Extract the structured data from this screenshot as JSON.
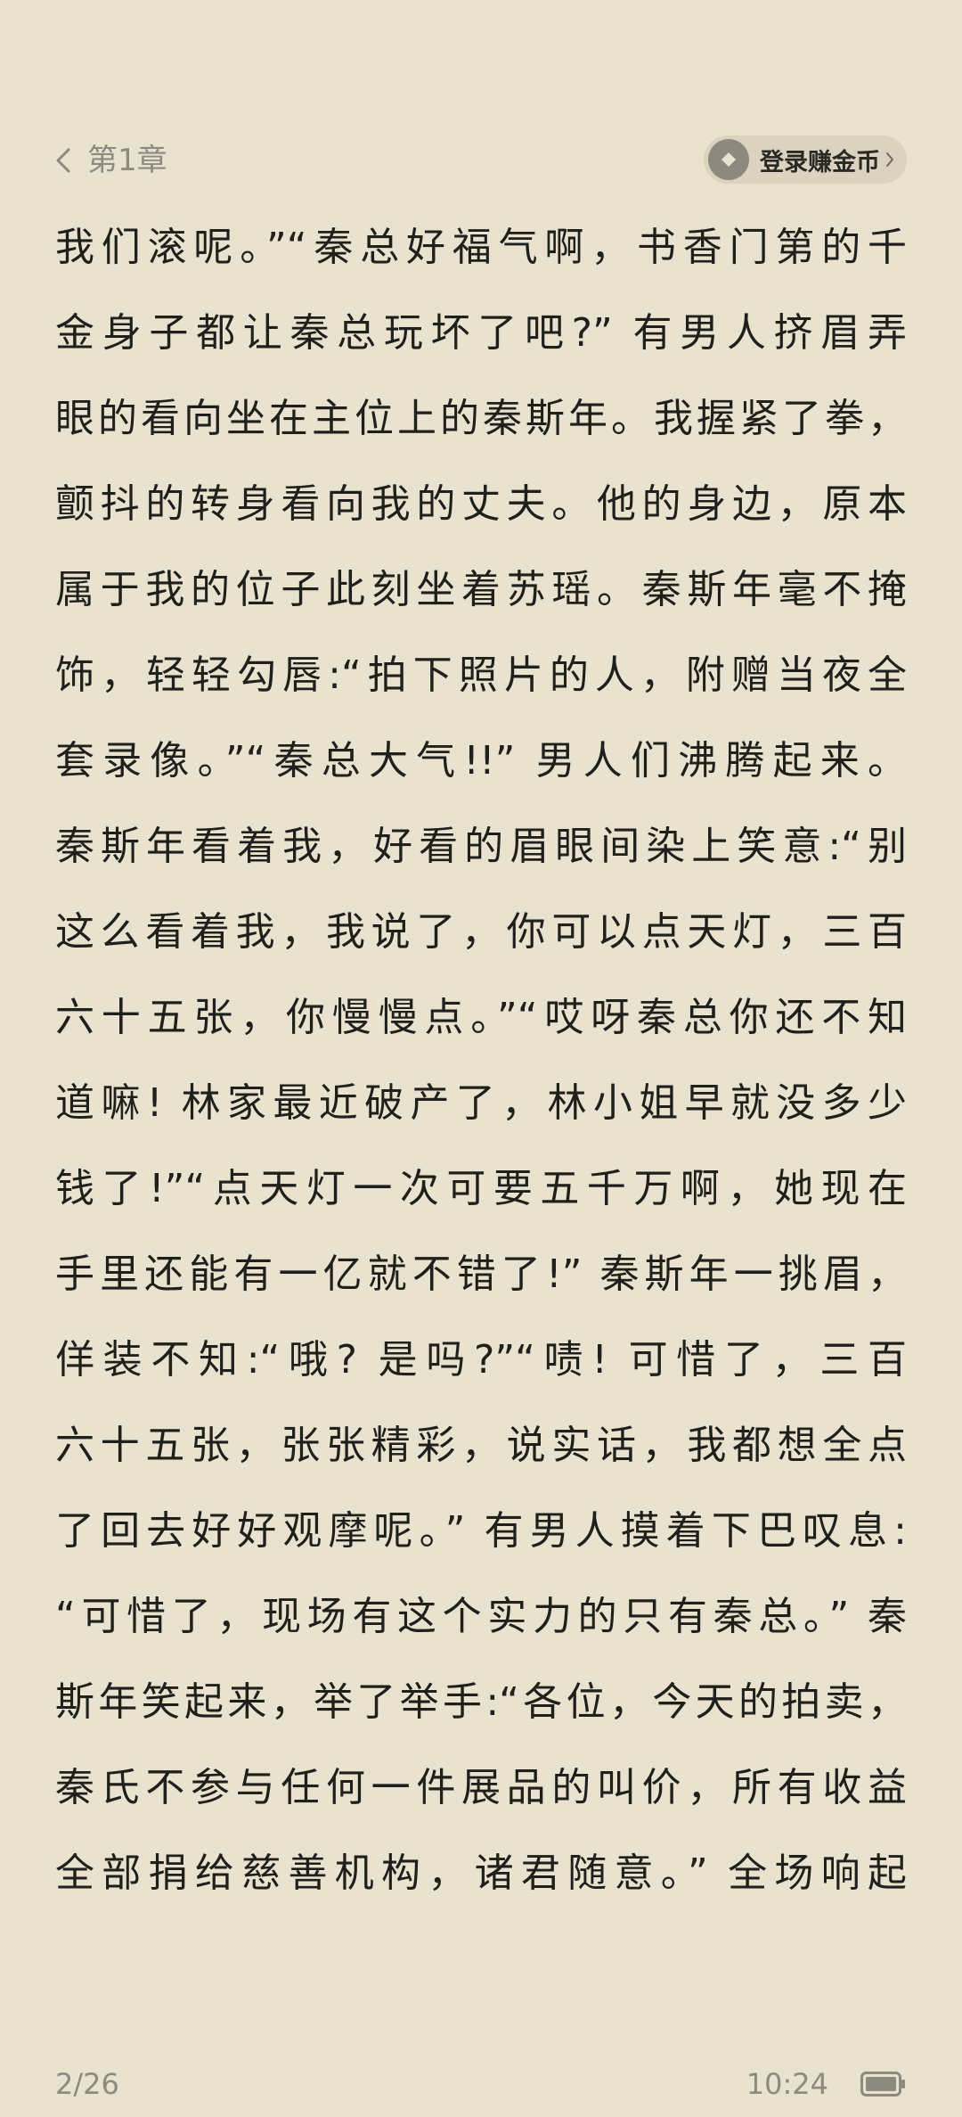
{
  "header": {
    "chapter": "第1章",
    "login_label": "登录赚金币"
  },
  "content": {
    "lines": [
      "我们滚呢。”“秦总好福气啊，书香门第的千",
      "金身子都让秦总玩坏了吧?” 有男人挤眉弄",
      "眼的看向坐在主位上的秦斯年。我握紧了拳，",
      "颤抖的转身看向我的丈夫。他的身边，原本",
      "属于我的位子此刻坐着苏瑶。秦斯年毫不掩",
      "饰，轻轻勾唇:“拍下照片的人，附赠当夜全",
      "套录像。”“秦总大气!!” 男人们沸腾起来。",
      "秦斯年看着我，好看的眉眼间染上笑意:“别",
      "这么看着我，我说了，你可以点天灯，三百",
      "六十五张，你慢慢点。”“哎呀秦总你还不知",
      "道嘛! 林家最近破产了，林小姐早就没多少",
      "钱了!”“点天灯一次可要五千万啊，她现在",
      "手里还能有一亿就不错了!” 秦斯年一挑眉，",
      "佯装不知:“哦? 是吗?”“啧! 可惜了，三百",
      "六十五张，张张精彩，说实话，我都想全点",
      "了回去好好观摩呢。” 有男人摸着下巴叹息:",
      "“可惜了，现场有这个实力的只有秦总。” 秦",
      "斯年笑起来，举了举手:“各位，今天的拍卖，",
      "秦氏不参与任何一件展品的叫价，所有收益",
      "全部捐给慈善机构，诸君随意。” 全场响起"
    ]
  },
  "footer": {
    "page": "2/26",
    "time": "10:24"
  },
  "icons": {
    "back": "chevron-left-icon",
    "coin": "coin-icon",
    "chevron": "chevron-right-icon",
    "battery": "battery-icon"
  },
  "colors": {
    "background": "#e9e2cf",
    "text": "#1f1f1c",
    "muted": "#8d8a80",
    "pill": "#dbd3bf"
  }
}
